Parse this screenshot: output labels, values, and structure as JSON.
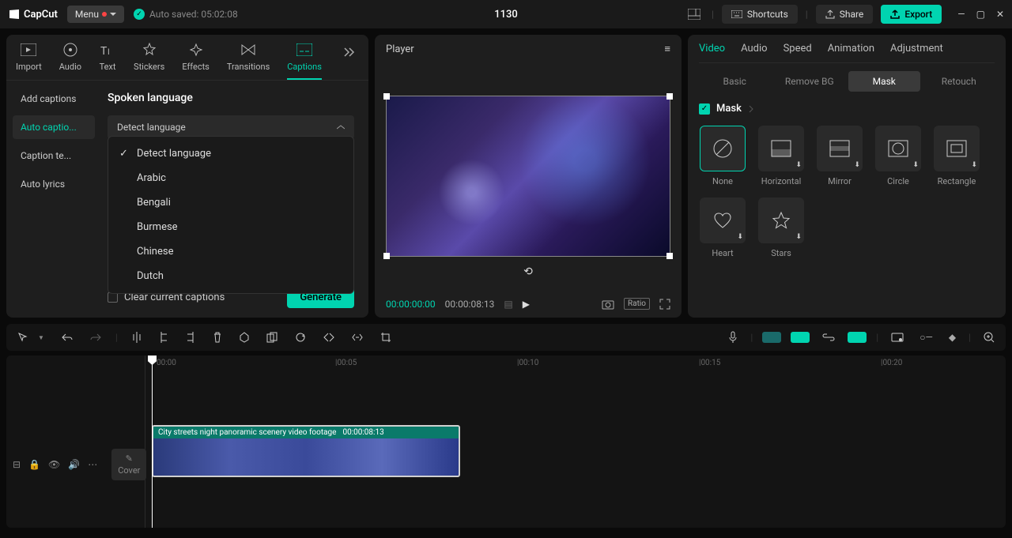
{
  "app": {
    "name": "CapCut",
    "menu": "Menu",
    "autosave": "Auto saved: 05:02:08",
    "title": "1130"
  },
  "topbar": {
    "shortcuts": "Shortcuts",
    "share": "Share",
    "export": "Export"
  },
  "tabs": {
    "import": "Import",
    "audio": "Audio",
    "text": "Text",
    "stickers": "Stickers",
    "effects": "Effects",
    "transitions": "Transitions",
    "captions": "Captions"
  },
  "subside": {
    "add": "Add captions",
    "auto": "Auto captio...",
    "template": "Caption te...",
    "lyrics": "Auto lyrics"
  },
  "captions": {
    "title": "Spoken language",
    "selected": "Detect language",
    "options": [
      "Detect language",
      "Arabic",
      "Bengali",
      "Burmese",
      "Chinese",
      "Dutch"
    ],
    "clear": "Clear current captions",
    "generate": "Generate"
  },
  "player": {
    "label": "Player",
    "cur": "00:00:00:00",
    "dur": "00:00:08:13",
    "ratio": "Ratio"
  },
  "right": {
    "tabs": {
      "video": "Video",
      "audio": "Audio",
      "speed": "Speed",
      "animation": "Animation",
      "adjustment": "Adjustment"
    },
    "subtabs": {
      "basic": "Basic",
      "removebg": "Remove BG",
      "mask": "Mask",
      "retouch": "Retouch"
    },
    "mask": "Mask",
    "masks": {
      "none": "None",
      "horizontal": "Horizontal",
      "mirror": "Mirror",
      "circle": "Circle",
      "rectangle": "Rectangle",
      "heart": "Heart",
      "stars": "Stars"
    }
  },
  "timeline": {
    "marks": [
      "00:00",
      "|00:05",
      "|00:10",
      "|00:15",
      "|00:20"
    ],
    "cover": "Cover",
    "clip_name": "City streets night panoramic scenery video footage",
    "clip_dur": "00:00:08:13"
  }
}
